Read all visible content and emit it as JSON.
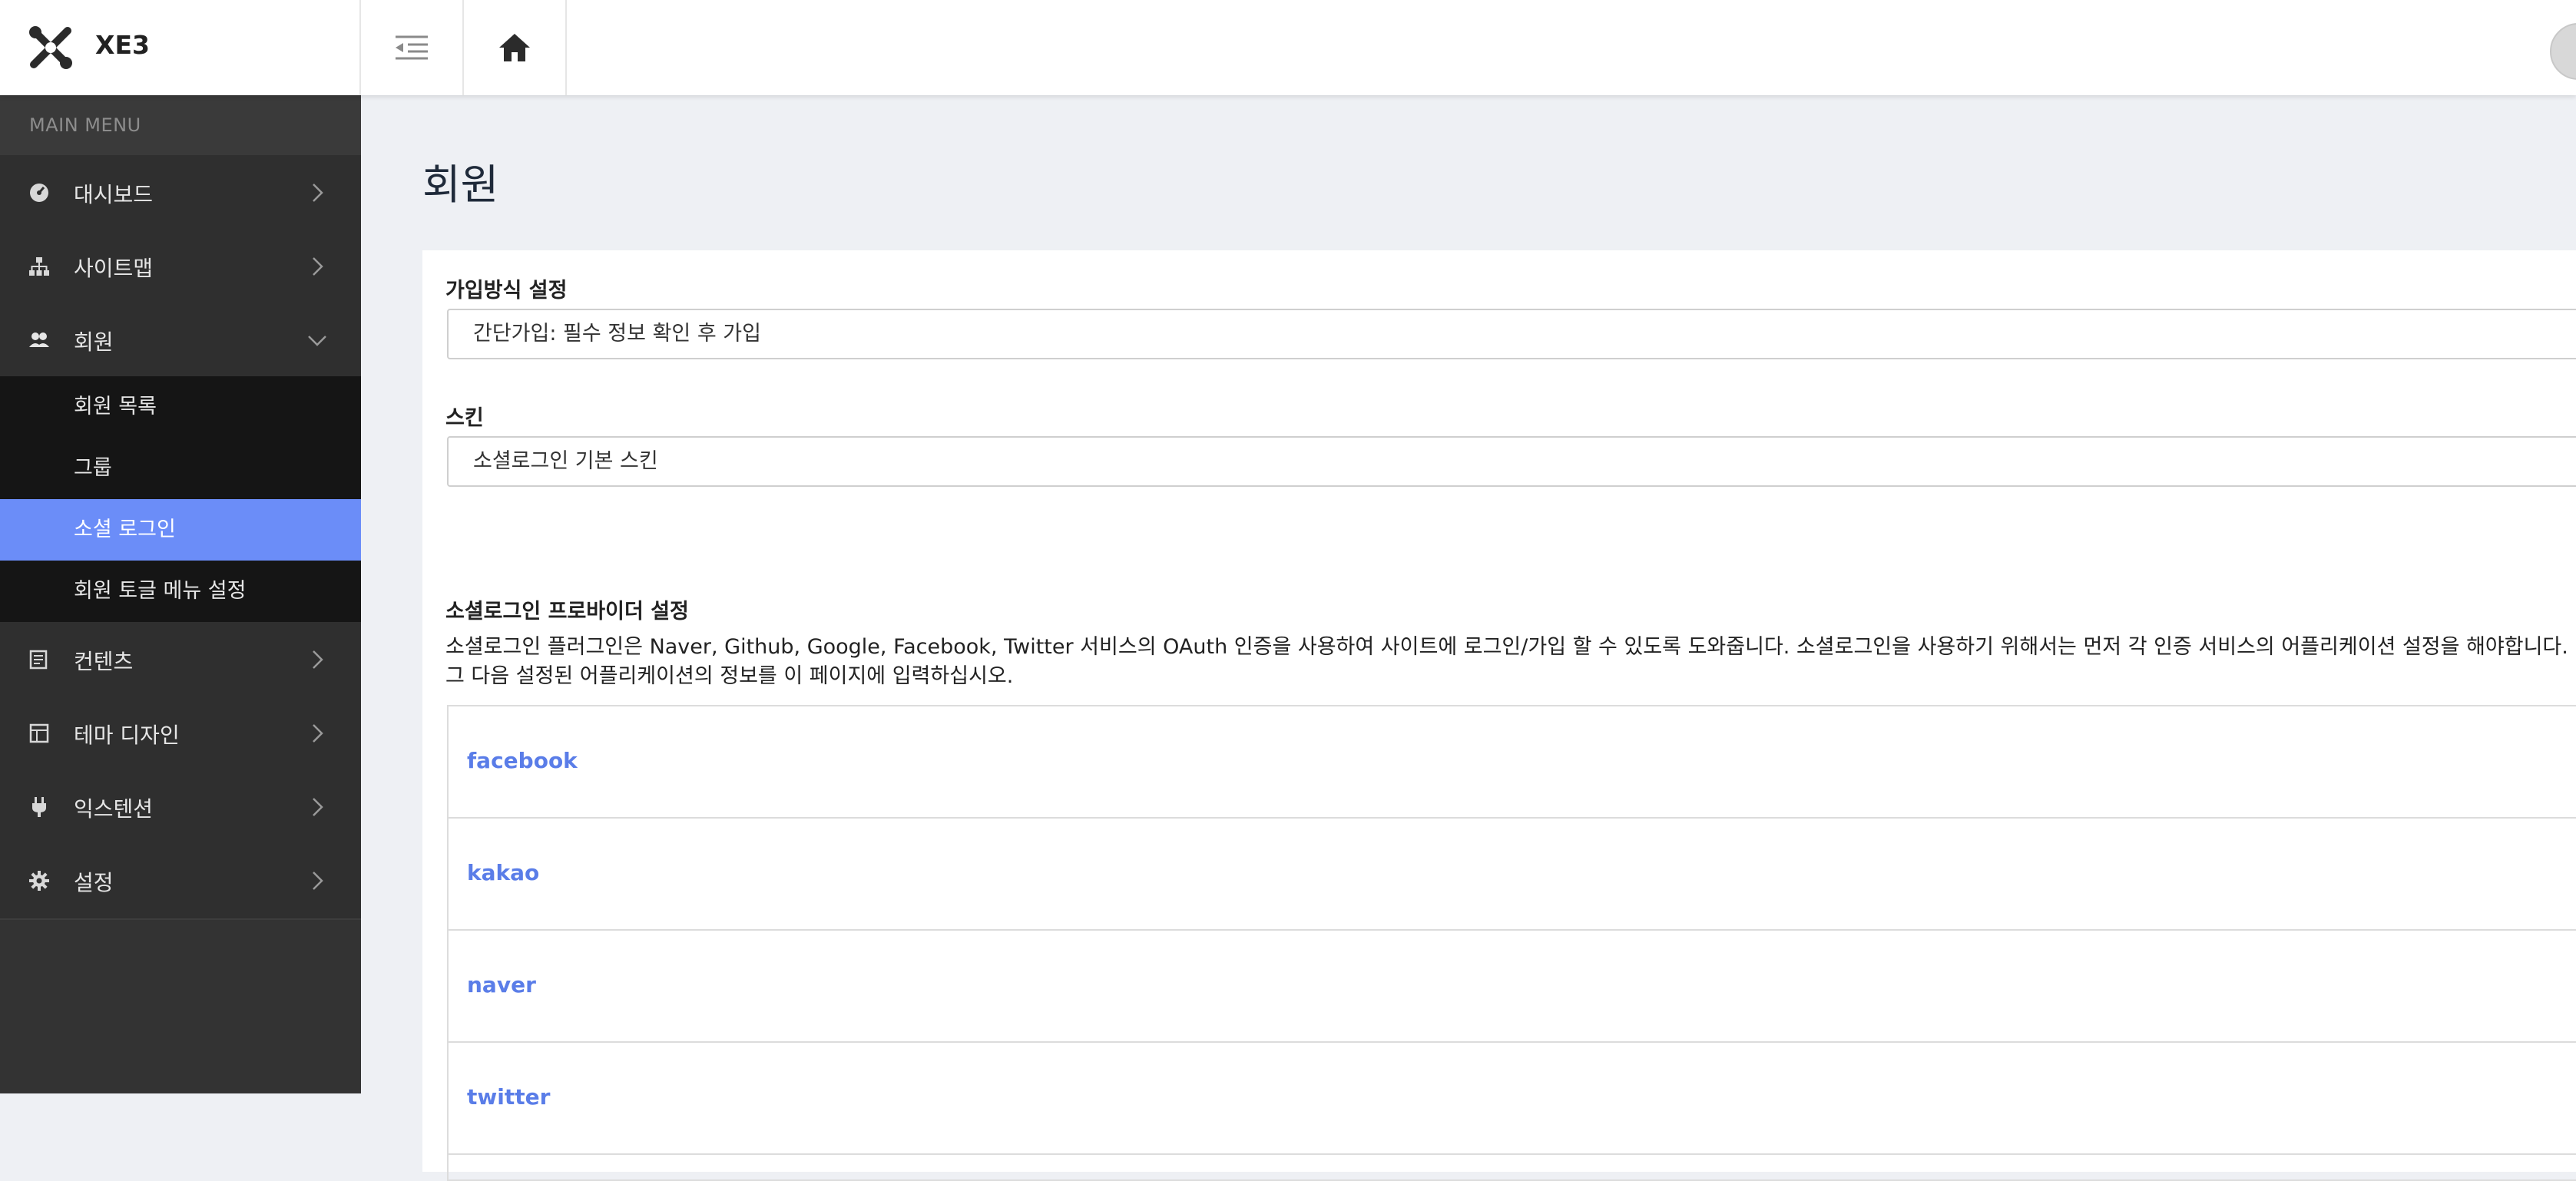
{
  "app": {
    "brand": "XE3"
  },
  "sidebar": {
    "menu_label": "MAIN MENU",
    "items": [
      {
        "label": "대시보드",
        "icon": "dashboard-icon",
        "expanded": false
      },
      {
        "label": "사이트맵",
        "icon": "sitemap-icon",
        "expanded": false
      },
      {
        "label": "회원",
        "icon": "users-icon",
        "expanded": true,
        "children": [
          {
            "label": "회원 목록",
            "active": false
          },
          {
            "label": "그룹",
            "active": false
          },
          {
            "label": "소셜 로그인",
            "active": true
          },
          {
            "label": "회원 토글 메뉴 설정",
            "active": false
          }
        ]
      },
      {
        "label": "컨텐츠",
        "icon": "content-icon",
        "expanded": false
      },
      {
        "label": "테마 디자인",
        "icon": "theme-icon",
        "expanded": false
      },
      {
        "label": "익스텐션",
        "icon": "plug-icon",
        "expanded": false
      },
      {
        "label": "설정",
        "icon": "gear-icon",
        "expanded": false
      }
    ]
  },
  "main": {
    "page_title": "회원",
    "signup": {
      "label": "가입방식 설정",
      "value": "간단가입: 필수 정보 확인 후 가입"
    },
    "skin": {
      "label": "스킨",
      "value": "소셜로그인 기본 스킨"
    },
    "providers": {
      "title": "소셜로그인 프로바이더 설정",
      "desc_line1": "소셜로그인 플러그인은 Naver, Github, Google, Facebook, Twitter 서비스의 OAuth 인증을 사용하여 사이트에 로그인/가입 할 수 있도록 도와줍니다. 소셜로그인을 사용하기 위해서는 먼저 각 인증 서비스의 어플리케이션 설정을 해야합니다.",
      "desc_line2": "그 다음 설정된 어플리케이션의 정보를 이 페이지에 입력하십시오.",
      "items": [
        "facebook",
        "kakao",
        "naver",
        "twitter"
      ]
    }
  },
  "colors": {
    "accent": "#6b8df8",
    "sidebar": "#2f2f2f",
    "link": "#5a7de8"
  }
}
